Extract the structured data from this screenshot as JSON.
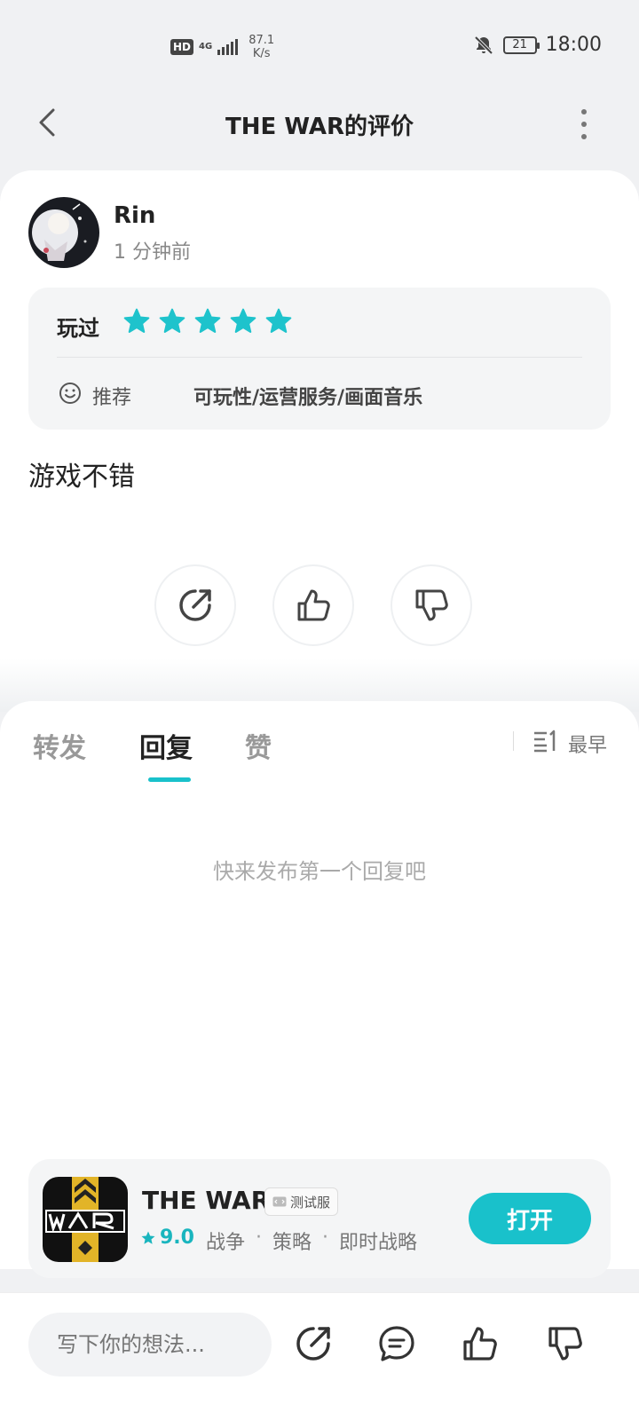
{
  "status_bar": {
    "hd": "HD",
    "network": "4G",
    "speed_value": "87.1",
    "speed_unit": "K/s",
    "battery": "21",
    "time": "18:00"
  },
  "nav": {
    "title": "THE WAR的评价"
  },
  "review": {
    "username": "Rin",
    "posted_time": "1 分钟前",
    "played_label": "玩过",
    "stars": 5,
    "recommend_label": "推荐",
    "aspects": "可玩性/运营服务/画面音乐",
    "text": "游戏不错"
  },
  "tabs": {
    "items": [
      {
        "label": "转发"
      },
      {
        "label": "回复"
      },
      {
        "label": "赞"
      }
    ],
    "active": "回复",
    "sort_label": "最早",
    "empty_hint": "快来发布第一个回复吧"
  },
  "app_banner": {
    "name": "THE WAR",
    "badge": "测试服",
    "rating": "9.0",
    "tags": [
      "战争",
      "策略",
      "即时战略"
    ],
    "button": "打开"
  },
  "bottom_bar": {
    "placeholder": "写下你的想法..."
  },
  "colors": {
    "accent": "#19c1cb",
    "star": "#1ec3cc"
  }
}
